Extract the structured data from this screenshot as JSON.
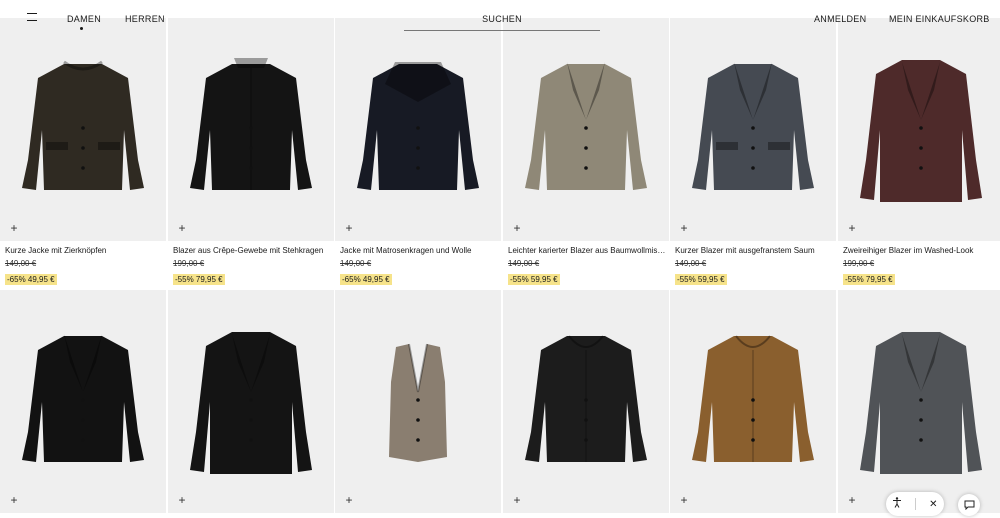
{
  "header": {
    "menu_icon": "hamburger-icon",
    "nav": {
      "damen": "DAMEN",
      "herren": "HERREN"
    },
    "search_label": "SUCHEN",
    "login": "ANMELDEN",
    "cart": "MEIN EINKAUFSKORB"
  },
  "products": [
    {
      "name": "Kurze Jacke mit Zierknöpfen",
      "old_price": "149,00 €",
      "sale": "-65% 49,95 €",
      "color": "#2f2a22",
      "style": "jacket-pockets"
    },
    {
      "name": "Blazer aus Crêpe-Gewebe mit Stehkragen",
      "old_price": "199,00 €",
      "sale": "-55% 79,95 €",
      "color": "#141414",
      "style": "stand-collar"
    },
    {
      "name": "Jacke mit Matrosenkragen und Wolle",
      "old_price": "149,00 €",
      "sale": "-65% 49,95 €",
      "color": "#171a24",
      "style": "sailor-collar"
    },
    {
      "name": "Leichter karierter Blazer aus Baumwollmischung",
      "old_price": "149,00 €",
      "sale": "-55% 59,95 €",
      "color": "#8f8877",
      "style": "blazer"
    },
    {
      "name": "Kurzer Blazer mit ausgefranstem Saum",
      "old_price": "149,00 €",
      "sale": "-55% 59,95 €",
      "color": "#454a52",
      "style": "blazer-pockets"
    },
    {
      "name": "Zweireihiger Blazer im Washed-Look",
      "old_price": "199,00 €",
      "sale": "-55% 79,95 €",
      "color": "#4e2a2a",
      "style": "blazer-long"
    },
    {
      "name": "",
      "old_price": "",
      "sale": "",
      "color": "#121212",
      "style": "blazer"
    },
    {
      "name": "",
      "old_price": "",
      "sale": "",
      "color": "#141414",
      "style": "blazer-long"
    },
    {
      "name": "",
      "old_price": "",
      "sale": "",
      "color": "#8a7e70",
      "style": "vest"
    },
    {
      "name": "",
      "old_price": "",
      "sale": "",
      "color": "#1c1c1c",
      "style": "collarless"
    },
    {
      "name": "",
      "old_price": "",
      "sale": "",
      "color": "#8a5f2e",
      "style": "collarless"
    },
    {
      "name": "",
      "old_price": "",
      "sale": "",
      "color": "#505357",
      "style": "blazer-long"
    }
  ],
  "add_icon": "plus-icon",
  "accessibility": {
    "icon": "accessibility-icon",
    "close_icon": "close-icon"
  },
  "chat_icon": "chat-icon"
}
